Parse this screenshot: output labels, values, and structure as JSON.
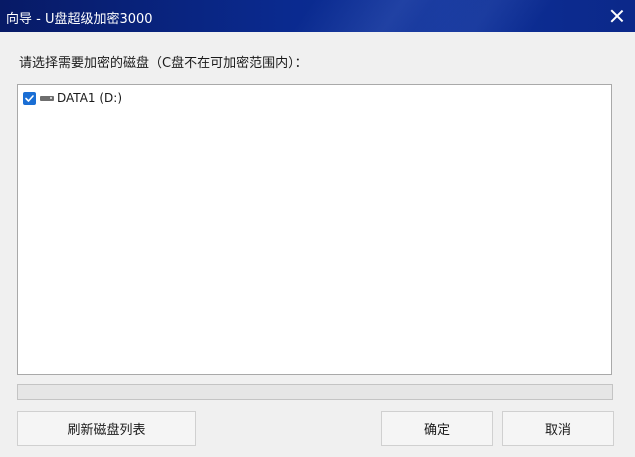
{
  "window": {
    "title": "向导 - U盘超级加密3000",
    "close_icon": "close-icon"
  },
  "main": {
    "prompt": "请选择需要加密的磁盘（C盘不在可加密范围内）：",
    "disks": [
      {
        "label": "DATA1 (D:)",
        "checked": true,
        "icon": "drive-icon"
      }
    ],
    "progress": 0
  },
  "buttons": {
    "refresh_label": "刷新磁盘列表",
    "ok_label": "确定",
    "cancel_label": "取消"
  },
  "colors": {
    "titlebar": "#0a2a8f",
    "checkbox": "#1a6ed4"
  }
}
